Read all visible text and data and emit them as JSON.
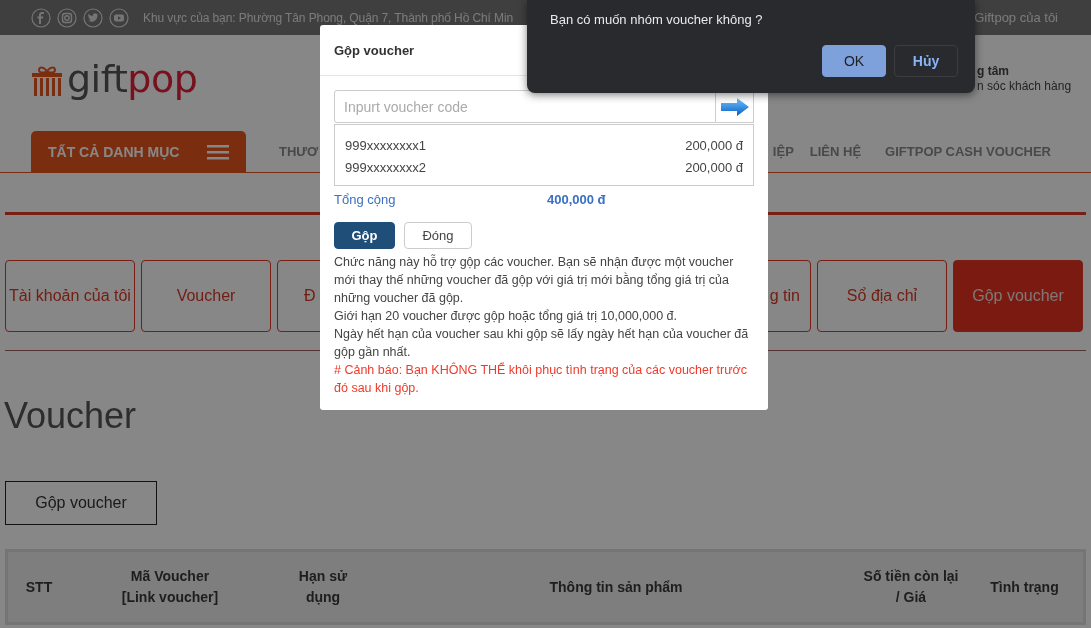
{
  "top_bar": {
    "region_text": "Khu vực của bạn: Phường Tân Phong, Quận 7, Thành phố Hồ Chí Min",
    "account_link": "Giftpop của tôi"
  },
  "logo": {
    "parts": [
      "gift",
      "pop"
    ]
  },
  "support": {
    "title": "g tâm",
    "subtitle": "n sóc khách hàng"
  },
  "nav": {
    "category_button": "TẤT CẢ DANH MỤC",
    "items": [
      {
        "label": "THƯƠ",
        "kind": "clipped_end"
      },
      {
        "label": "IỆP",
        "kind": "clipped_start"
      },
      {
        "label": "LIÊN HỆ",
        "kind": "full"
      },
      {
        "label": "GIFTPOP CASH VOUCHER",
        "kind": "full"
      }
    ]
  },
  "account_tabs": [
    {
      "label": "Tài khoản của tôi",
      "kind": "full",
      "selected": false
    },
    {
      "label": "Voucher",
      "kind": "full",
      "selected": false
    },
    {
      "label": "Đ",
      "kind": "clipped_end",
      "selected": false
    },
    {
      "label": "g tin",
      "kind": "clipped_start",
      "selected": false
    },
    {
      "label": "Sổ địa chỉ",
      "kind": "full",
      "selected": false
    },
    {
      "label": "Gộp voucher",
      "kind": "full",
      "selected": true
    }
  ],
  "page_title": "Voucher",
  "merge_button": "Gộp voucher",
  "table": {
    "columns": [
      "STT",
      "Mã Voucher\n[Link voucher]",
      "Hạn sử\ndụng",
      "Thông tin sản phẩm",
      "Số tiền còn lại\n/ Giá",
      "Tình trạng"
    ]
  },
  "merge_modal": {
    "title": "Gộp voucher",
    "input": {
      "placeholder": "Inpurt voucher code"
    },
    "vouchers": [
      {
        "code": "999xxxxxxxx1",
        "amount": "200,000 đ"
      },
      {
        "code": "999xxxxxxxx2",
        "amount": "200,000 đ"
      }
    ],
    "total_label": "Tổng cộng",
    "total_value": "400,000 đ",
    "buttons": [
      {
        "label": "Gộp",
        "kind": "primary"
      },
      {
        "label": "Đóng",
        "kind": "secondary"
      }
    ],
    "notes": [
      "Chức năng này hỗ trợ gộp các voucher. Bạn sẽ nhận được một voucher mới thay thế những voucher đã gộp với giá trị mới bằng tổng giá trị của những voucher đã gộp.",
      "Giới hạn 20 voucher được gộp hoặc tổng giá trị 10,000,000 đ.",
      "Ngày hết hạn của voucher sau khi gộp sẽ lấy ngày hết hạn của voucher đã gộp gần nhất."
    ],
    "warning": "# Cảnh báo: Bạn KHÔNG THỂ khôi phục tình trạng của các voucher trước đó sau khi gộp."
  },
  "confirm_dialog": {
    "message": "Bạn có muốn nhóm voucher không ?",
    "buttons": [
      {
        "label": "OK",
        "kind": "primary"
      },
      {
        "label": "Hủy",
        "kind": "secondary"
      }
    ]
  }
}
